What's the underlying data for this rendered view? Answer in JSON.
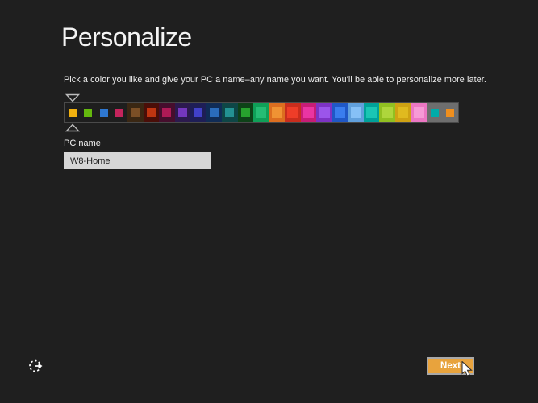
{
  "page": {
    "title": "Personalize",
    "subtitle": "Pick a color you like and give your PC a name–any name you want. You'll be able to personalize more later.",
    "background": "#1f1f1f"
  },
  "color_slider": {
    "selected_index": 0,
    "selected_accent": "#f0b00f",
    "segments": [
      {
        "bg": "#1e1e1e",
        "accent": "#f0b00f",
        "size": "small"
      },
      {
        "bg": "#1e1e1e",
        "accent": "#64b80e",
        "size": "small"
      },
      {
        "bg": "#1e1e1e",
        "accent": "#2e77d0",
        "size": "small"
      },
      {
        "bg": "#1e1e1e",
        "accent": "#c4245c",
        "size": "small"
      },
      {
        "bg": "#3a2713",
        "accent": "#7b4f26",
        "size": "medium"
      },
      {
        "bg": "#4a0e08",
        "accent": "#bf3511",
        "size": "medium"
      },
      {
        "bg": "#460e2d",
        "accent": "#ae1a56",
        "size": "medium"
      },
      {
        "bg": "#2c1a4e",
        "accent": "#7437bd",
        "size": "medium"
      },
      {
        "bg": "#1e1e56",
        "accent": "#4141c8",
        "size": "medium"
      },
      {
        "bg": "#102c56",
        "accent": "#2a6cbc",
        "size": "medium"
      },
      {
        "bg": "#0e4646",
        "accent": "#239292",
        "size": "medium"
      },
      {
        "bg": "#0e4218",
        "accent": "#27a12e",
        "size": "medium"
      },
      {
        "bg": "#0fa058",
        "accent": "#25bd74",
        "size": "large"
      },
      {
        "bg": "#dc6e20",
        "accent": "#f09333",
        "size": "large"
      },
      {
        "bg": "#c92d1d",
        "accent": "#ee3d28",
        "size": "large"
      },
      {
        "bg": "#c71d76",
        "accent": "#ea35a2",
        "size": "large"
      },
      {
        "bg": "#7d33c4",
        "accent": "#9b55ea",
        "size": "large"
      },
      {
        "bg": "#2058c6",
        "accent": "#3a7dee",
        "size": "large"
      },
      {
        "bg": "#61a0dc",
        "accent": "#86c0f6",
        "size": "large"
      },
      {
        "bg": "#00a29a",
        "accent": "#1ac6b4",
        "size": "large"
      },
      {
        "bg": "#91c021",
        "accent": "#aed63c",
        "size": "large"
      },
      {
        "bg": "#cfa213",
        "accent": "#e0ba1f",
        "size": "large"
      },
      {
        "bg": "#ec77c3",
        "accent": "#f79ad6",
        "size": "large"
      },
      {
        "bg": "#6e6e6e",
        "accent": "#00aba9",
        "size": "small"
      },
      {
        "bg": "#6e6e6e",
        "accent": "#ef8f1e",
        "size": "small"
      }
    ]
  },
  "pc_name": {
    "label": "PC name",
    "value": "W8-Home"
  },
  "footer": {
    "next_label": "Next",
    "next_color": "#e8a33d"
  },
  "icons": {
    "ease_of_access": "ease-of-access-icon",
    "slider_marker_top": "slider-marker-down-icon",
    "slider_marker_bottom": "slider-marker-up-icon",
    "cursor": "mouse-cursor-icon"
  }
}
